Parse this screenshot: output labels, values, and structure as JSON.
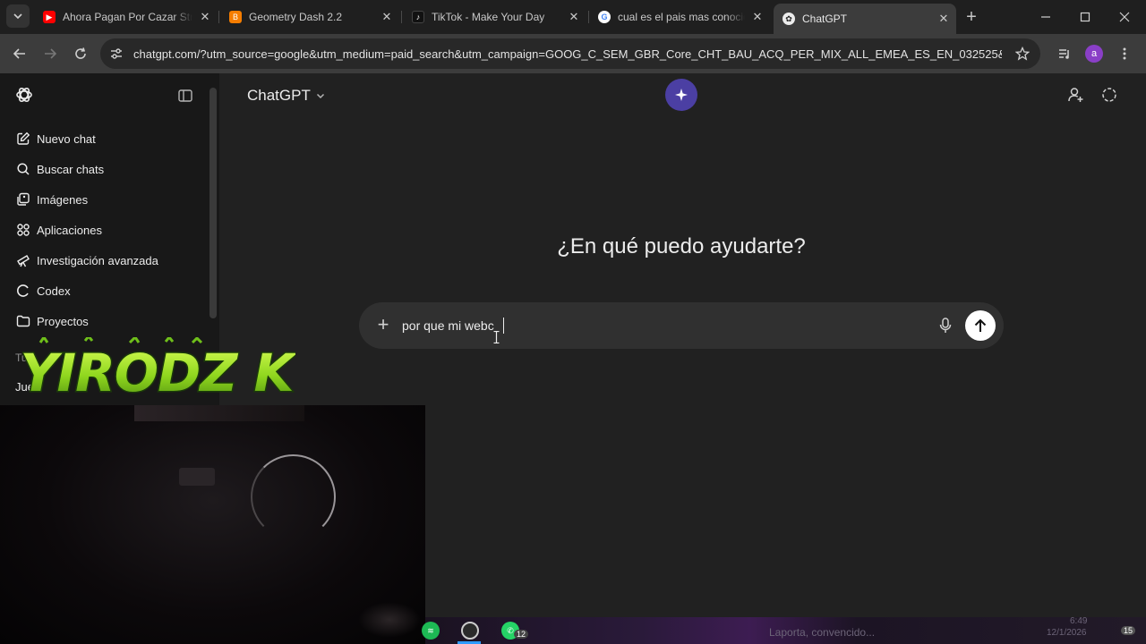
{
  "browser": {
    "tabs": [
      {
        "title": "Ahora Pagan Por Cazar Streamers",
        "favicon": "youtube-icon",
        "color": "#ff0000"
      },
      {
        "title": "Geometry Dash 2.2",
        "favicon": "blogger-icon",
        "color": "#f57d00"
      },
      {
        "title": "TikTok - Make Your Day",
        "favicon": "tiktok-icon",
        "color": "#000000"
      },
      {
        "title": "cual es el pais mas conocido",
        "favicon": "google-icon",
        "color": "#4285f4"
      },
      {
        "title": "ChatGPT",
        "favicon": "openai-icon",
        "color": "#ececec",
        "active": true
      }
    ],
    "url": "chatgpt.com/?utm_source=google&utm_medium=paid_search&utm_campaign=GOOG_C_SEM_GBR_Core_CHT_BAU_ACQ_PER_MIX_ALL_EMEA_ES_EN_032525&c_id=...",
    "profile_initial": "a"
  },
  "sidebar": {
    "items": [
      {
        "label": "Nuevo chat",
        "icon": "compose-icon"
      },
      {
        "label": "Buscar chats",
        "icon": "search-icon"
      },
      {
        "label": "Imágenes",
        "icon": "images-icon"
      },
      {
        "label": "Aplicaciones",
        "icon": "apps-icon"
      },
      {
        "label": "Investigación avanzada",
        "icon": "telescope-icon"
      },
      {
        "label": "Codex",
        "icon": "codex-icon"
      },
      {
        "label": "Proyectos",
        "icon": "folder-icon"
      }
    ],
    "partial_labels": [
      "Tu",
      "Jue"
    ]
  },
  "main": {
    "model": "ChatGPT",
    "headline": "¿En qué puedo ayudarte?",
    "composer": {
      "value": "por que mi webc"
    }
  },
  "overlay": {
    "streamer_logo": "YIRODZ K"
  },
  "taskbar": {
    "whatsapp_badge": "12",
    "notification": "Laporta, convencido...",
    "time": "6:49",
    "date": "12/1/2026",
    "notifications_count": "15"
  },
  "colors": {
    "sidebar_bg": "#181818",
    "main_bg": "#212121",
    "composer_bg": "#303030",
    "accent": "#4b3fa3",
    "logo_green": "#9be12a"
  }
}
